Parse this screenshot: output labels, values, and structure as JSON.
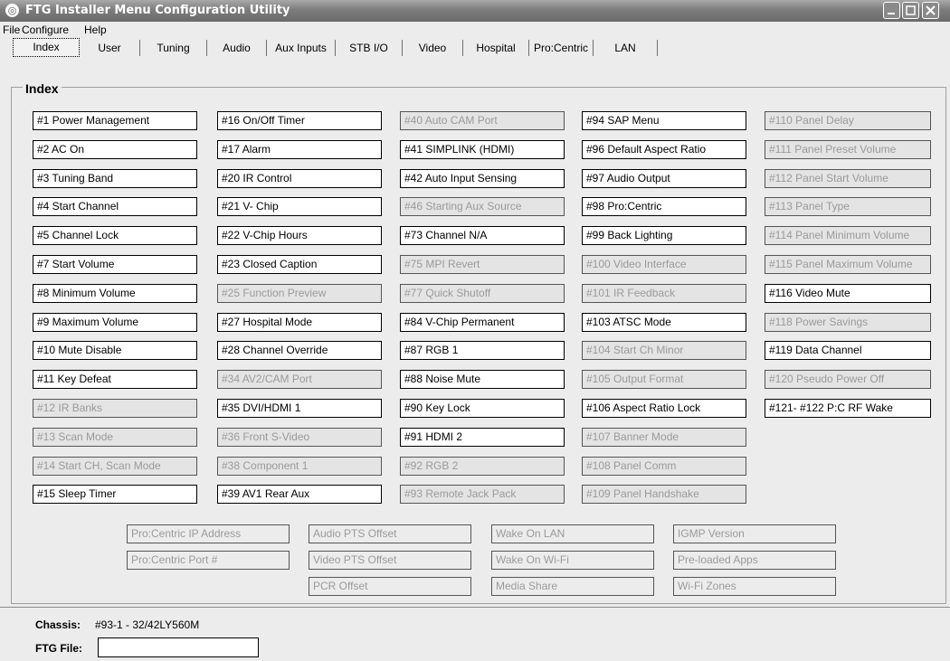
{
  "window": {
    "title": "FTG Installer Menu Configuration Utility"
  },
  "menubar": {
    "file": "File",
    "configure": "Configure",
    "help": "Help"
  },
  "tabs": [
    "Index",
    "User",
    "Tuning",
    "Audio",
    "Aux Inputs",
    "STB I/O",
    "Video",
    "Hospital",
    "Pro:Centric",
    "LAN"
  ],
  "index": {
    "heading": "Index",
    "columns": [
      [
        {
          "label": "#1 Power Management",
          "enabled": true
        },
        {
          "label": "#2 AC On",
          "enabled": true
        },
        {
          "label": "#3 Tuning Band",
          "enabled": true
        },
        {
          "label": "#4 Start Channel",
          "enabled": true
        },
        {
          "label": "#5 Channel Lock",
          "enabled": true
        },
        {
          "label": "#7 Start Volume",
          "enabled": true
        },
        {
          "label": "#8 Minimum Volume",
          "enabled": true
        },
        {
          "label": "#9 Maximum Volume",
          "enabled": true
        },
        {
          "label": "#10 Mute Disable",
          "enabled": true
        },
        {
          "label": "#11 Key Defeat",
          "enabled": true
        },
        {
          "label": "#12 IR Banks",
          "enabled": false
        },
        {
          "label": "#13 Scan Mode",
          "enabled": false
        },
        {
          "label": "#14 Start CH, Scan Mode",
          "enabled": false
        },
        {
          "label": "#15 Sleep Timer",
          "enabled": true
        }
      ],
      [
        {
          "label": "#16 On/Off Timer",
          "enabled": true
        },
        {
          "label": "#17 Alarm",
          "enabled": true
        },
        {
          "label": "#20 IR Control",
          "enabled": true
        },
        {
          "label": "#21 V- Chip",
          "enabled": true
        },
        {
          "label": "#22 V-Chip Hours",
          "enabled": true
        },
        {
          "label": "#23 Closed Caption",
          "enabled": true
        },
        {
          "label": "#25 Function Preview",
          "enabled": false
        },
        {
          "label": "#27 Hospital Mode",
          "enabled": true
        },
        {
          "label": "#28 Channel Override",
          "enabled": true
        },
        {
          "label": "#34 AV2/CAM Port",
          "enabled": false
        },
        {
          "label": "#35 DVI/HDMI 1",
          "enabled": true
        },
        {
          "label": "#36 Front S-Video",
          "enabled": false
        },
        {
          "label": "#38 Component 1",
          "enabled": false
        },
        {
          "label": "#39 AV1 Rear Aux",
          "enabled": true
        }
      ],
      [
        {
          "label": "#40 Auto CAM Port",
          "enabled": false
        },
        {
          "label": "#41 SIMPLINK (HDMI)",
          "enabled": true
        },
        {
          "label": "#42 Auto Input Sensing",
          "enabled": true
        },
        {
          "label": "#46 Starting Aux Source",
          "enabled": false
        },
        {
          "label": "#73 Channel N/A",
          "enabled": true
        },
        {
          "label": "#75 MPI Revert",
          "enabled": false
        },
        {
          "label": "#77 Quick Shutoff",
          "enabled": false
        },
        {
          "label": "#84 V-Chip Permanent",
          "enabled": true
        },
        {
          "label": "#87 RGB 1",
          "enabled": true
        },
        {
          "label": "#88 Noise Mute",
          "enabled": true
        },
        {
          "label": "#90 Key Lock",
          "enabled": true
        },
        {
          "label": "#91 HDMI 2",
          "enabled": true
        },
        {
          "label": "#92 RGB 2",
          "enabled": false
        },
        {
          "label": "#93 Remote Jack Pack",
          "enabled": false
        }
      ],
      [
        {
          "label": "#94 SAP Menu",
          "enabled": true
        },
        {
          "label": "#96 Default Aspect Ratio",
          "enabled": true
        },
        {
          "label": "#97 Audio Output",
          "enabled": true
        },
        {
          "label": "#98 Pro:Centric",
          "enabled": true
        },
        {
          "label": "#99 Back Lighting",
          "enabled": true
        },
        {
          "label": "#100 Video Interface",
          "enabled": false
        },
        {
          "label": "#101 IR Feedback",
          "enabled": false
        },
        {
          "label": "#103 ATSC Mode",
          "enabled": true
        },
        {
          "label": "#104 Start Ch Minor",
          "enabled": false
        },
        {
          "label": "#105 Output Format",
          "enabled": false
        },
        {
          "label": "#106 Aspect Ratio Lock",
          "enabled": true
        },
        {
          "label": "#107 Banner Mode",
          "enabled": false
        },
        {
          "label": "#108 Panel Comm",
          "enabled": false
        },
        {
          "label": "#109 Panel Handshake",
          "enabled": false
        }
      ],
      [
        {
          "label": "#110 Panel Delay",
          "enabled": false
        },
        {
          "label": "#111 Panel Preset Volume",
          "enabled": false
        },
        {
          "label": "#112 Panel Start Volume",
          "enabled": false
        },
        {
          "label": "#113 Panel Type",
          "enabled": false
        },
        {
          "label": "#114 Panel Minimum Volume",
          "enabled": false
        },
        {
          "label": "#115 Panel Maximum Volume",
          "enabled": false
        },
        {
          "label": "#116 Video Mute",
          "enabled": true
        },
        {
          "label": "#118 Power Savings",
          "enabled": false
        },
        {
          "label": "#119 Data Channel",
          "enabled": true
        },
        {
          "label": "#120 Pseudo Power Off",
          "enabled": false
        },
        {
          "label": "#121- #122 P:C RF Wake",
          "enabled": true
        }
      ]
    ],
    "extra_rows": [
      [
        "Pro:Centric IP Address",
        "Audio PTS Offset",
        "Wake On LAN",
        "IGMP Version"
      ],
      [
        "Pro:Centric Port #",
        "Video PTS Offset",
        "Wake On  Wi-Fi",
        "Pre-loaded Apps"
      ],
      [
        "",
        "PCR Offset",
        "Media Share",
        "Wi-Fi Zones"
      ]
    ]
  },
  "status": {
    "chassis_label": "Chassis:",
    "chassis_value": "#93-1 - 32/42LY560M",
    "ftg_label": "FTG File:",
    "ftg_value": ""
  }
}
